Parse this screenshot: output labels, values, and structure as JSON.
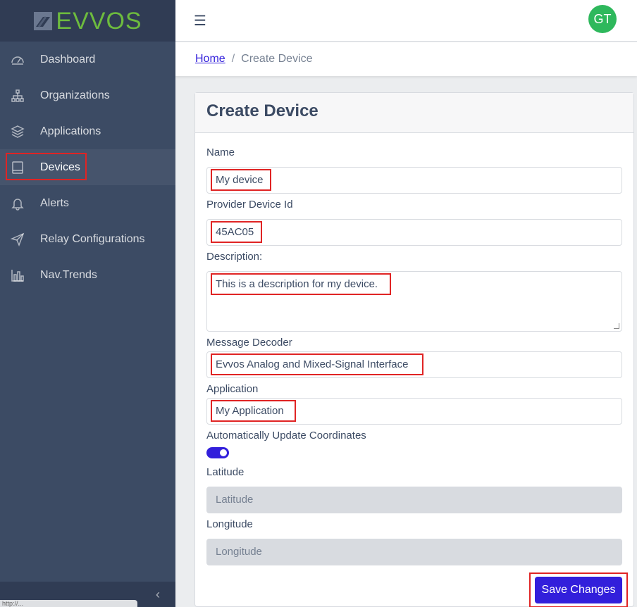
{
  "brand": {
    "name": "EVVOS",
    "color": "#6dbb3e"
  },
  "sidebar": {
    "items": [
      {
        "label": "Dashboard",
        "icon": "speedometer-icon"
      },
      {
        "label": "Organizations",
        "icon": "sitemap-icon"
      },
      {
        "label": "Applications",
        "icon": "layers-icon"
      },
      {
        "label": "Devices",
        "icon": "tablet-icon",
        "active": true
      },
      {
        "label": "Alerts",
        "icon": "bell-icon"
      },
      {
        "label": "Relay Configurations",
        "icon": "paper-plane-icon"
      },
      {
        "label": "Nav.Trends",
        "icon": "bar-chart-icon"
      }
    ],
    "collapse_glyph": "‹",
    "status_url": "http://..."
  },
  "header": {
    "menu_glyph": "☰",
    "avatar_initials": "GT",
    "avatar_color": "#2eb85c"
  },
  "breadcrumb": {
    "home": "Home",
    "separator": "/",
    "current": "Create Device"
  },
  "form": {
    "title": "Create Device",
    "name": {
      "label": "Name",
      "value": "My device"
    },
    "provider_id": {
      "label": "Provider Device Id",
      "value": "45AC05"
    },
    "description": {
      "label": "Description:",
      "value": "This is a description for my device."
    },
    "decoder": {
      "label": "Message Decoder",
      "value": "Evvos Analog and Mixed-Signal Interface"
    },
    "application": {
      "label": "Application",
      "value": "My Application"
    },
    "auto_update": {
      "label": "Automatically Update Coordinates",
      "enabled": true
    },
    "latitude": {
      "label": "Latitude",
      "placeholder": "Latitude"
    },
    "longitude": {
      "label": "Longitude",
      "placeholder": "Longitude"
    },
    "save_label": "Save Changes"
  },
  "colors": {
    "primary": "#321fdb",
    "sidebar": "#3c4b64",
    "highlight": "#e02424"
  }
}
